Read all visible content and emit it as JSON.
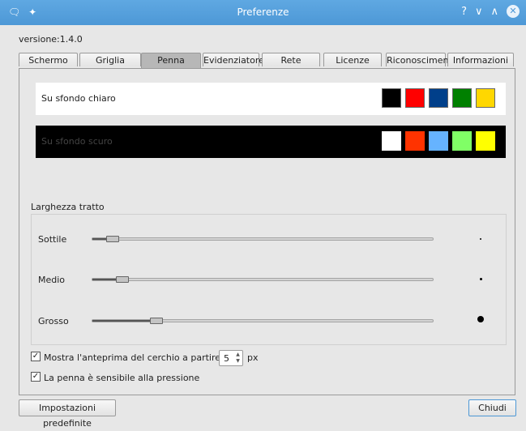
{
  "window": {
    "title": "Preferenze",
    "left_icons": [
      "chat-bubble-icon",
      "pin-icon"
    ],
    "controls": [
      "help-icon",
      "minimize-icon",
      "maximize-icon",
      "close-icon"
    ],
    "accent": "#4d98d6"
  },
  "version_label": "versione:1.4.0",
  "tabs": [
    {
      "label": "Schermo"
    },
    {
      "label": "Griglia"
    },
    {
      "label": "Penna",
      "active": true
    },
    {
      "label": "Evidenziatore"
    },
    {
      "label": "Rete"
    },
    {
      "label": "Licenze"
    },
    {
      "label": "Riconoscimenti"
    },
    {
      "label": "Informazioni su"
    }
  ],
  "light_background": {
    "label": "Su sfondo chiaro",
    "colors": [
      "#000000",
      "#ff0000",
      "#003f8a",
      "#008000",
      "#ffd700"
    ]
  },
  "dark_background": {
    "label": "Su sfondo scuro",
    "colors": [
      "#ffffff",
      "#ff3300",
      "#66b3ff",
      "#80ff66",
      "#ffff00"
    ]
  },
  "stroke_width": {
    "title": "Larghezza tratto",
    "rows": [
      {
        "label": "Sottile",
        "level": 0.04
      },
      {
        "label": "Medio",
        "level": 0.07
      },
      {
        "label": "Grosso",
        "level": 0.17
      }
    ]
  },
  "options": {
    "preview_circle": {
      "label": "Mostra l'anteprima del cerchio a partire da",
      "checked": true,
      "value": "5",
      "unit": "px"
    },
    "pressure": {
      "label": "La penna è sensibile alla pressione",
      "checked": true
    }
  },
  "buttons": {
    "defaults": "Impostazioni predefinite",
    "close": "Chiudi"
  }
}
